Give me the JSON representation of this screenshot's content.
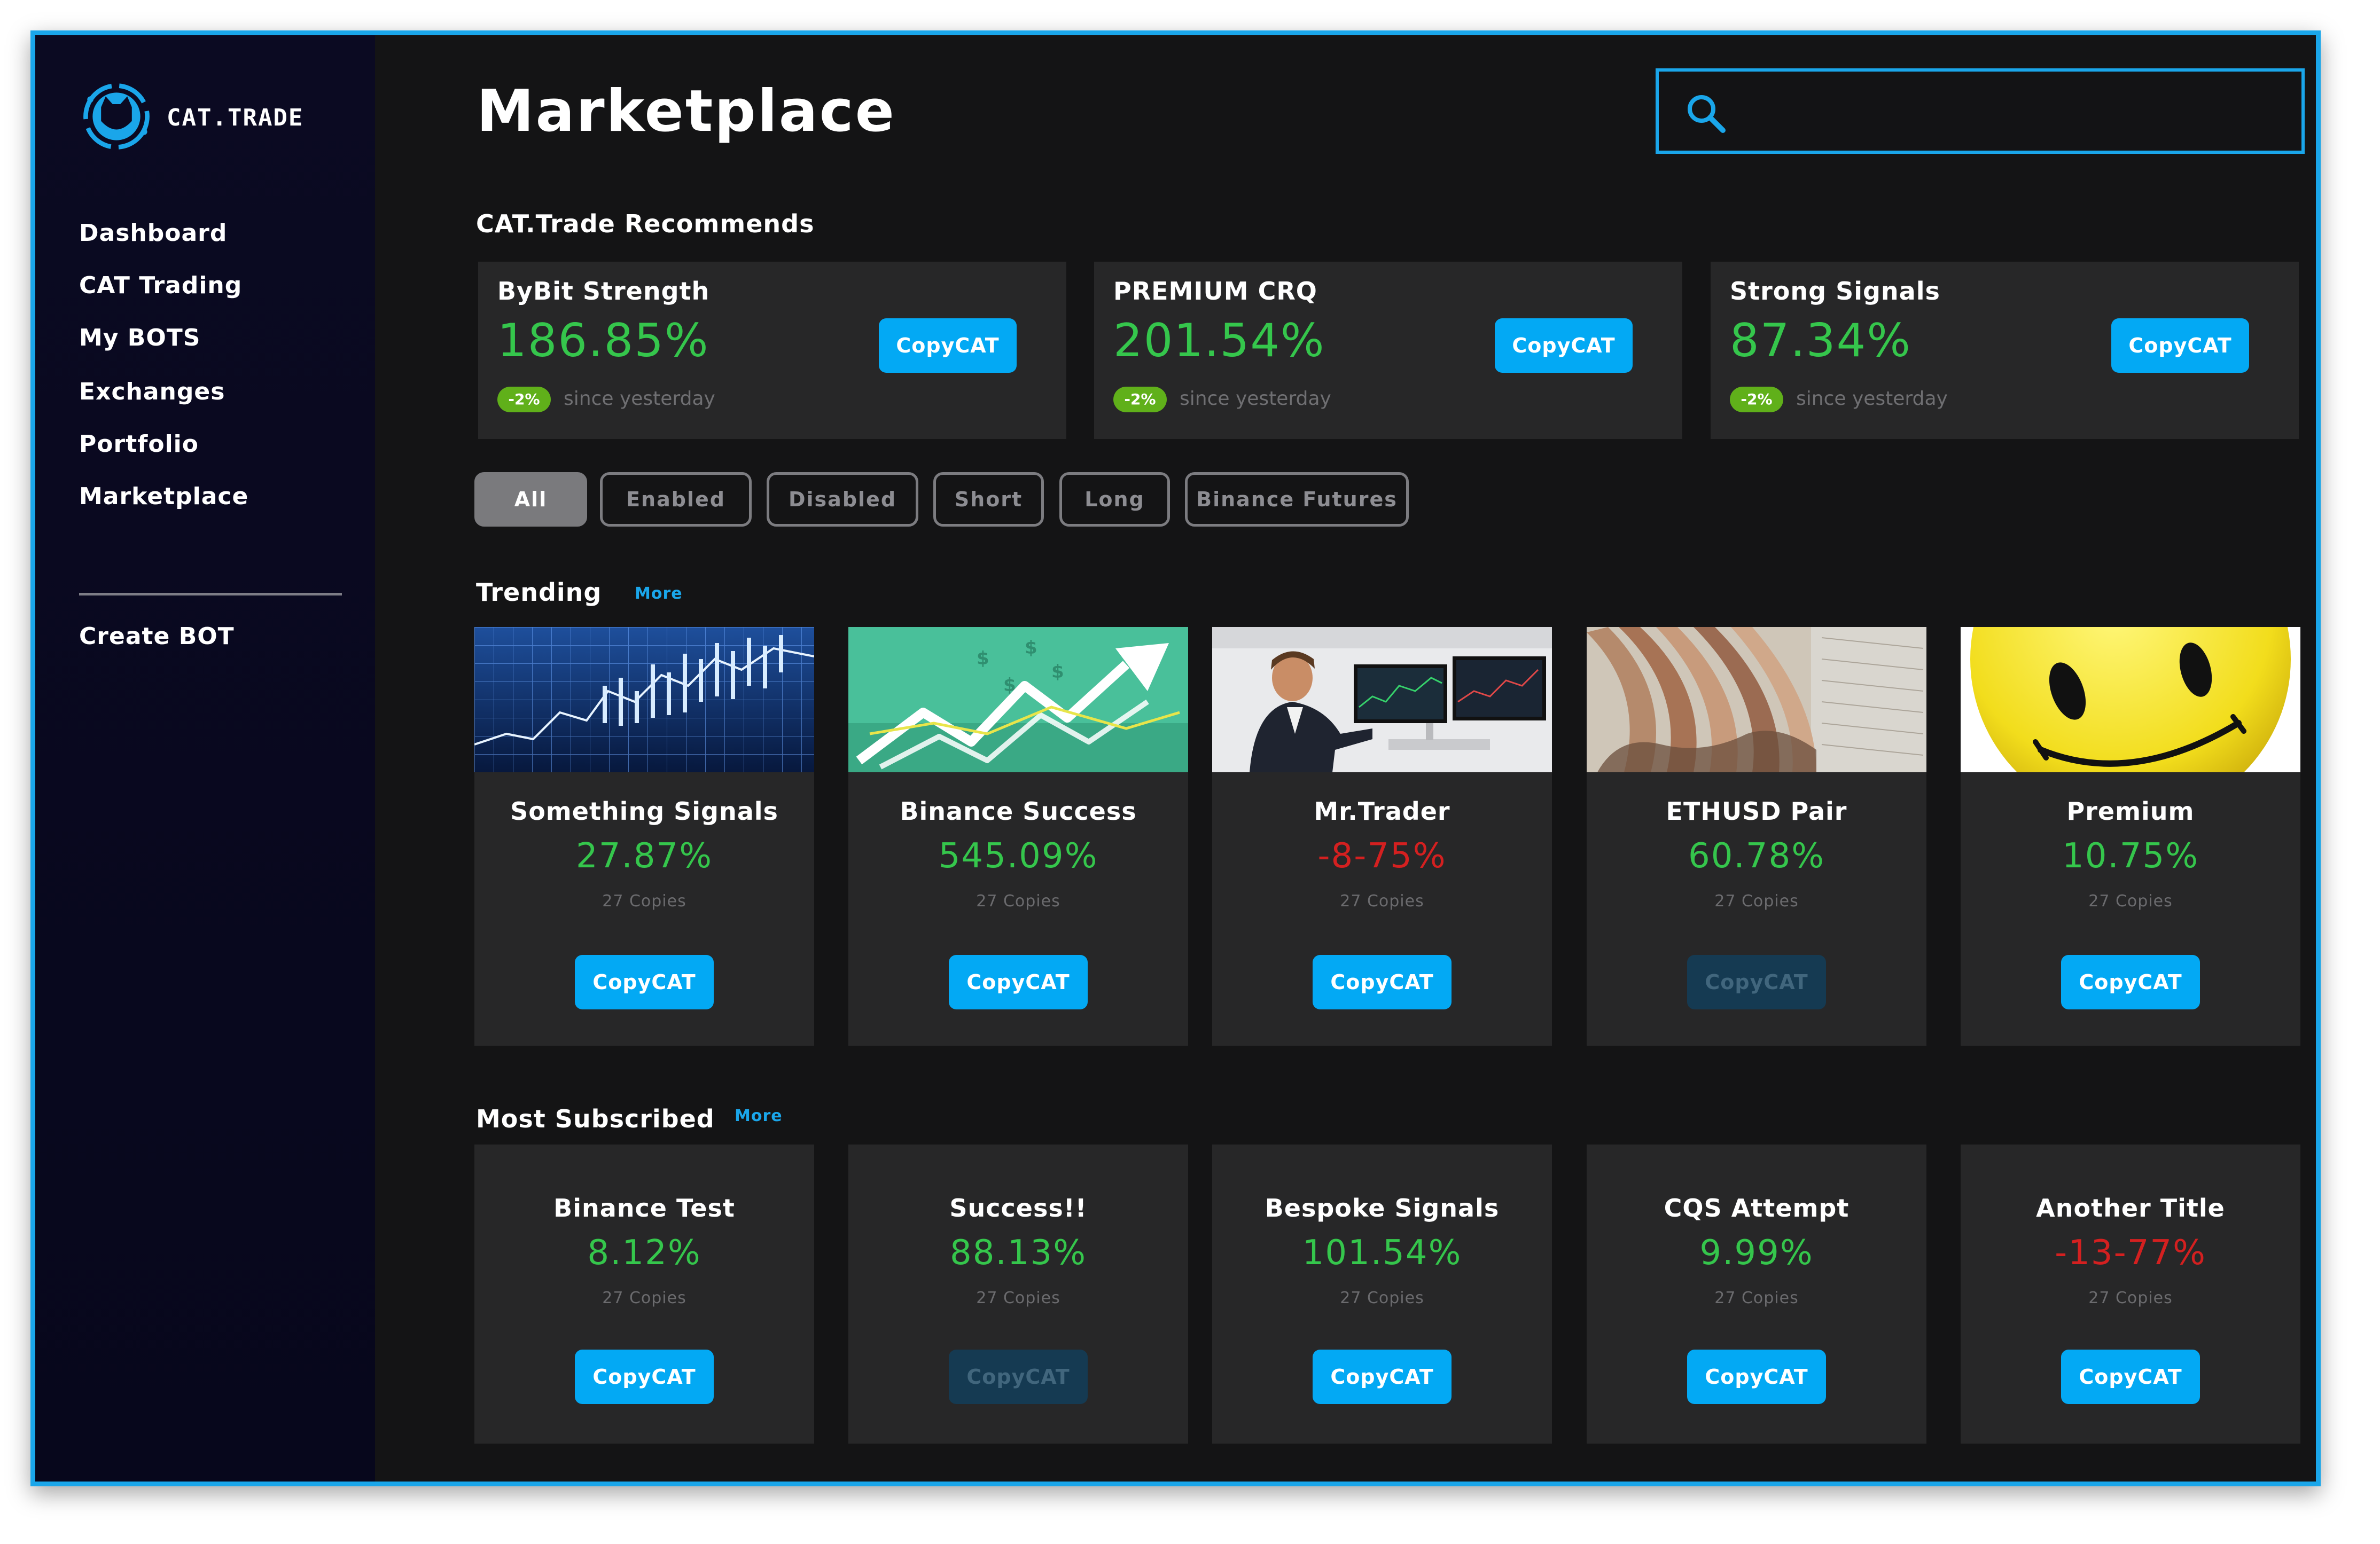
{
  "app": {
    "brand": "CAT.TRADE"
  },
  "sidebar": {
    "items": [
      {
        "label": "Dashboard"
      },
      {
        "label": "CAT Trading"
      },
      {
        "label": "My BOTS"
      },
      {
        "label": "Exchanges"
      },
      {
        "label": "Portfolio"
      },
      {
        "label": "Marketplace"
      }
    ],
    "create_label": "Create BOT"
  },
  "header": {
    "title": "Marketplace",
    "search_placeholder": ""
  },
  "recommends": {
    "heading": "CAT.Trade Recommends",
    "cards": [
      {
        "name": "ByBit Strength",
        "percent": "186.85%",
        "badge": "-2%",
        "since": "since yesterday",
        "button": "CopyCAT"
      },
      {
        "name": "PREMIUM CRQ",
        "percent": "201.54%",
        "badge": "-2%",
        "since": "since yesterday",
        "button": "CopyCAT"
      },
      {
        "name": "Strong Signals",
        "percent": "87.34%",
        "badge": "-2%",
        "since": "since yesterday",
        "button": "CopyCAT"
      }
    ]
  },
  "filters": {
    "items": [
      {
        "label": "All",
        "active": true
      },
      {
        "label": "Enabled",
        "active": false
      },
      {
        "label": "Disabled",
        "active": false
      },
      {
        "label": "Short",
        "active": false
      },
      {
        "label": "Long",
        "active": false
      },
      {
        "label": "Binance Futures",
        "active": false
      }
    ]
  },
  "trending": {
    "heading": "Trending",
    "more": "More",
    "cards": [
      {
        "title": "Something Signals",
        "percent": "27.87%",
        "trend": "positive",
        "copies": "27 Copies",
        "button": "CopyCAT",
        "enabled": true,
        "image": "stock-chart-image"
      },
      {
        "title": "Binance Success",
        "percent": "545.09%",
        "trend": "positive",
        "copies": "27 Copies",
        "button": "CopyCAT",
        "enabled": true,
        "image": "growth-arrow-image"
      },
      {
        "title": "Mr.Trader",
        "percent": "-8-75%",
        "trend": "negative",
        "copies": "27 Copies",
        "button": "CopyCAT",
        "enabled": true,
        "image": "trader-at-screens-image"
      },
      {
        "title": "ETHUSD Pair",
        "percent": "60.78%",
        "trend": "positive",
        "copies": "27 Copies",
        "button": "CopyCAT",
        "enabled": false,
        "image": "banknotes-image"
      },
      {
        "title": "Premium",
        "percent": "10.75%",
        "trend": "positive",
        "copies": "27 Copies",
        "button": "CopyCAT",
        "enabled": true,
        "image": "smiley-face-image"
      }
    ]
  },
  "most_subscribed": {
    "heading": "Most Subscribed",
    "more": "More",
    "cards": [
      {
        "title": "Binance Test",
        "percent": "8.12%",
        "trend": "positive",
        "copies": "27 Copies",
        "button": "CopyCAT",
        "enabled": true
      },
      {
        "title": "Success!!",
        "percent": "88.13%",
        "trend": "positive",
        "copies": "27 Copies",
        "button": "CopyCAT",
        "enabled": false
      },
      {
        "title": "Bespoke Signals",
        "percent": "101.54%",
        "trend": "positive",
        "copies": "27 Copies",
        "button": "CopyCAT",
        "enabled": true
      },
      {
        "title": "CQS Attempt",
        "percent": "9.99%",
        "trend": "positive",
        "copies": "27 Copies",
        "button": "CopyCAT",
        "enabled": true
      },
      {
        "title": "Another Title",
        "percent": "-13-77%",
        "trend": "negative",
        "copies": "27 Copies",
        "button": "CopyCAT",
        "enabled": true
      }
    ]
  },
  "colors": {
    "accent": "#03a9f4",
    "positive": "#35c64c",
    "negative": "#d42020",
    "badge": "#60b01a",
    "frame": "#1aa6ea",
    "card": "#272728",
    "sidebar": "#0b0a22"
  }
}
